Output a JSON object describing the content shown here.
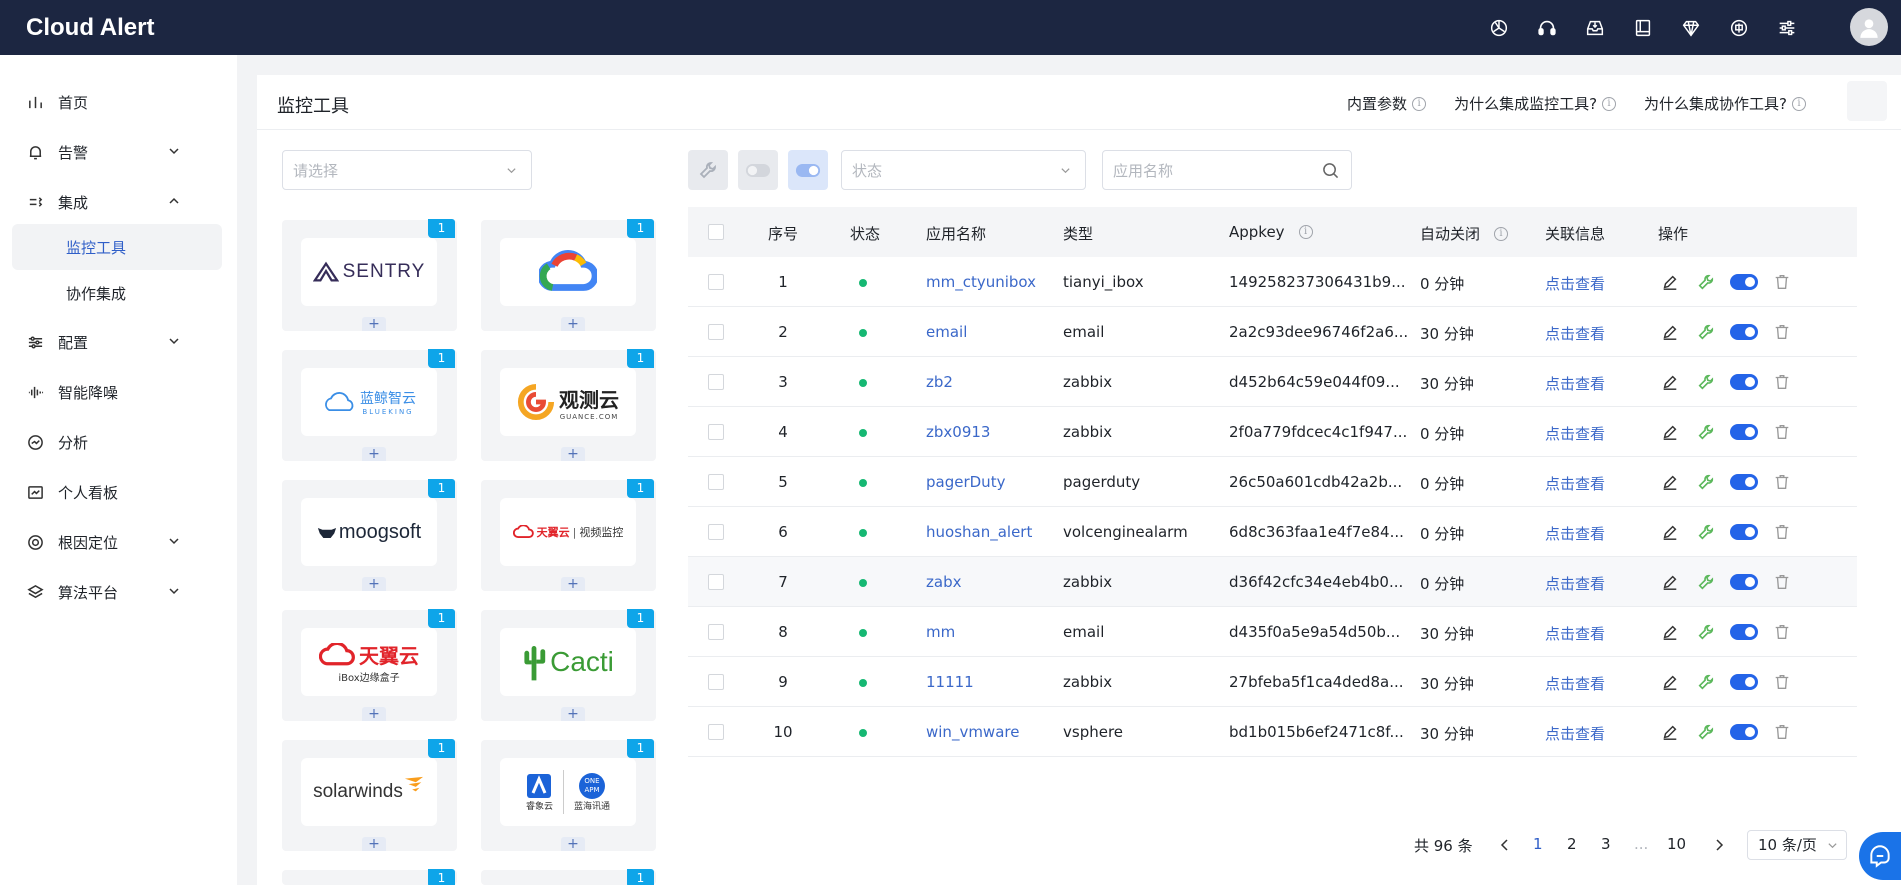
{
  "app": {
    "title": "Cloud Alert"
  },
  "topbar": {
    "icons": [
      "openai-icon",
      "headset-icon",
      "inbox-icon",
      "book-icon",
      "diamond-icon",
      "language-icon",
      "settings-sliders-icon"
    ]
  },
  "sidebar": {
    "items": [
      {
        "label": "首页",
        "icon": "bar-chart-icon"
      },
      {
        "label": "告警",
        "icon": "bell-icon",
        "expandable": true
      },
      {
        "label": "集成",
        "icon": "integration-icon",
        "expanded": true
      },
      {
        "label": "配置",
        "icon": "sliders-icon",
        "expandable": true
      },
      {
        "label": "智能降噪",
        "icon": "waveform-icon"
      },
      {
        "label": "分析",
        "icon": "gauge-icon"
      },
      {
        "label": "个人看板",
        "icon": "board-chart-icon"
      },
      {
        "label": "根因定位",
        "icon": "target-icon",
        "expandable": true
      },
      {
        "label": "算法平台",
        "icon": "layers-icon",
        "expandable": true
      }
    ],
    "sub_items": [
      {
        "label": "监控工具",
        "active": true
      },
      {
        "label": "协作集成",
        "active": false
      }
    ]
  },
  "page": {
    "title": "监控工具",
    "links": [
      "内置参数",
      "为什么集成监控工具?",
      "为什么集成协作工具?"
    ]
  },
  "left_panel": {
    "select_placeholder": "请选择",
    "tools": [
      {
        "name": "SENTRY",
        "badge": "1"
      },
      {
        "name": "Google Cloud",
        "badge": "1"
      },
      {
        "name": "蓝鲸智云",
        "sub": "BLUEKING",
        "badge": "1"
      },
      {
        "name": "观测云",
        "sub": "GUANCE.COM",
        "badge": "1"
      },
      {
        "name": "moogsoft",
        "badge": "1"
      },
      {
        "name": "天翼云",
        "sub": "视频监控",
        "badge": "1"
      },
      {
        "name": "天翼云",
        "sub": "iBox边缘盒子",
        "badge": "1"
      },
      {
        "name": "Cacti",
        "badge": "1"
      },
      {
        "name": "solarwinds",
        "badge": "1"
      },
      {
        "name": "睿象云",
        "sub": "蓝海讯通",
        "badge": "1",
        "extra": "ONE APM"
      }
    ],
    "plus": "+"
  },
  "filters": {
    "status_placeholder": "状态",
    "app_name_placeholder": "应用名称"
  },
  "table": {
    "headers": {
      "index": "序号",
      "status": "状态",
      "app_name": "应用名称",
      "type": "类型",
      "appkey": "Appkey",
      "auto_close": "自动关闭",
      "related": "关联信息",
      "ops": "操作"
    },
    "rows": [
      {
        "index": "1",
        "name": "mm_ctyunibox",
        "type": "tianyi_ibox",
        "appkey": "149258237306431b9...",
        "auto_close": "0 分钟",
        "related": "点击查看"
      },
      {
        "index": "2",
        "name": "email",
        "type": "email",
        "appkey": "2a2c93dee96746f2a6...",
        "auto_close": "30 分钟",
        "related": "点击查看"
      },
      {
        "index": "3",
        "name": "zb2",
        "type": "zabbix",
        "appkey": "d452b64c59e044f09...",
        "auto_close": "30 分钟",
        "related": "点击查看"
      },
      {
        "index": "4",
        "name": "zbx0913",
        "type": "zabbix",
        "appkey": "2f0a779fdcec4c1f947...",
        "auto_close": "0 分钟",
        "related": "点击查看"
      },
      {
        "index": "5",
        "name": "pagerDuty",
        "type": "pagerduty",
        "appkey": "26c50a601cdb42a2b...",
        "auto_close": "0 分钟",
        "related": "点击查看"
      },
      {
        "index": "6",
        "name": "huoshan_alert",
        "type": "volcenginealarm",
        "appkey": "6d8c363faa1e4f7e84...",
        "auto_close": "0 分钟",
        "related": "点击查看"
      },
      {
        "index": "7",
        "name": "zabx",
        "type": "zabbix",
        "appkey": "d36f42cfc34e4eb4b0...",
        "auto_close": "0 分钟",
        "related": "点击查看"
      },
      {
        "index": "8",
        "name": "mm",
        "type": "email",
        "appkey": "d435f0a5e9a54d50b...",
        "auto_close": "30 分钟",
        "related": "点击查看"
      },
      {
        "index": "9",
        "name": "11111",
        "type": "zabbix",
        "appkey": "27bfeba5f1ca4ded8a...",
        "auto_close": "30 分钟",
        "related": "点击查看"
      },
      {
        "index": "10",
        "name": "win_vmware",
        "type": "vsphere",
        "appkey": "bd1b015b6ef2471c8f...",
        "auto_close": "30 分钟",
        "related": "点击查看"
      }
    ]
  },
  "pagination": {
    "total": "共 96 条",
    "pages": [
      "1",
      "2",
      "3",
      "...",
      "10"
    ],
    "current": "1",
    "page_size": "10 条/页"
  }
}
